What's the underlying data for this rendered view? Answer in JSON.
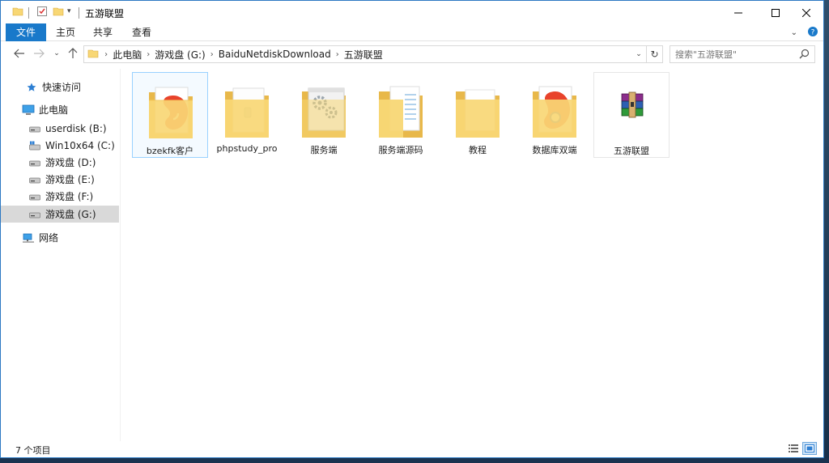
{
  "window": {
    "title": "五游联盟",
    "controls": {
      "minimize": "—",
      "maximize": "☐",
      "close": "✕"
    }
  },
  "ribbon": {
    "tabs": [
      "文件",
      "主页",
      "共享",
      "查看"
    ]
  },
  "address": {
    "crumbs": [
      "此电脑",
      "游戏盘 (G:)",
      "BaiduNetdiskDownload",
      "五游联盟"
    ]
  },
  "search": {
    "placeholder": "搜索\"五游联盟\""
  },
  "navpane": {
    "quick_access": "快速访问",
    "this_pc": "此电脑",
    "drives": [
      {
        "label": "userdisk (B:)",
        "icon": "drive-icon"
      },
      {
        "label": "Win10x64 (C:)",
        "icon": "system-drive-icon"
      },
      {
        "label": "游戏盘 (D:)",
        "icon": "drive-icon"
      },
      {
        "label": "游戏盘 (E:)",
        "icon": "drive-icon"
      },
      {
        "label": "游戏盘 (F:)",
        "icon": "drive-icon"
      },
      {
        "label": "游戏盘 (G:)",
        "icon": "drive-icon",
        "selected": true
      }
    ],
    "network": "网络"
  },
  "items": [
    {
      "name": "bzekfk客户",
      "type": "folder-red-app",
      "selected": true
    },
    {
      "name": "phpstudy_pro",
      "type": "folder-doc"
    },
    {
      "name": "服务端",
      "type": "folder-gear"
    },
    {
      "name": "服务端源码",
      "type": "folder-files"
    },
    {
      "name": "教程",
      "type": "folder-plain"
    },
    {
      "name": "数据库双端",
      "type": "folder-red-app"
    },
    {
      "name": "五游联盟",
      "type": "winrar-archive"
    }
  ],
  "status": {
    "count": "7 个项目"
  },
  "colors": {
    "accent": "#1979ca",
    "folder": "#f8d775",
    "folder_dark": "#e8b84a",
    "selection": "#cce8ff"
  }
}
